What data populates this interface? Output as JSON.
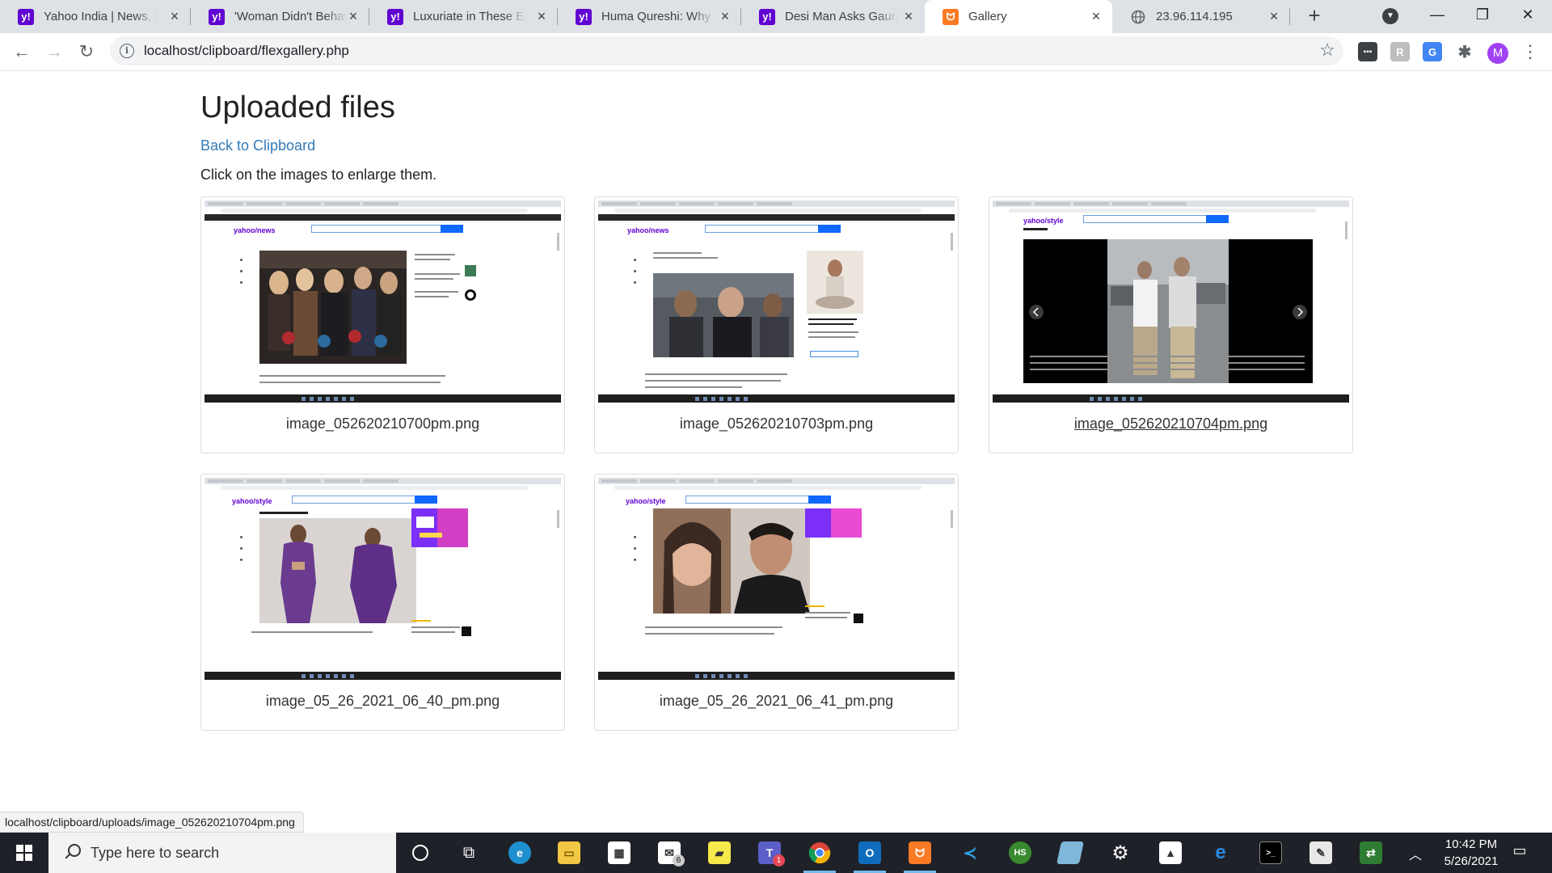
{
  "browser": {
    "tabs": [
      {
        "title": "Yahoo India | News, Fi",
        "favicon": "yahoo-icon",
        "active": false
      },
      {
        "title": "'Woman Didn't Behav",
        "favicon": "yahoo-icon",
        "active": false
      },
      {
        "title": "Luxuriate in These Ear",
        "favicon": "yahoo-icon",
        "active": false
      },
      {
        "title": "Huma Qureshi: Why D",
        "favicon": "yahoo-icon",
        "active": false
      },
      {
        "title": "Desi Man Asks Gauri K",
        "favicon": "yahoo-icon",
        "active": false
      },
      {
        "title": "Gallery",
        "favicon": "xampp-icon",
        "active": true
      },
      {
        "title": "23.96.114.195",
        "favicon": "globe-icon",
        "active": false
      }
    ],
    "url": "localhost/clipboard/flexgallery.php",
    "profile_initial": "M",
    "status_url": "localhost/clipboard/uploads/image_052620210704pm.png"
  },
  "page": {
    "heading": "Uploaded files",
    "back_link": "Back to Clipboard",
    "hint": "Click on the images to enlarge them.",
    "images": [
      {
        "filename": "image_052620210700pm.png",
        "preview": "yahoo/news"
      },
      {
        "filename": "image_052620210703pm.png",
        "preview": "yahoo/news"
      },
      {
        "filename": "image_052620210704pm.png",
        "preview": "yahoo/style",
        "hovered": true
      },
      {
        "filename": "image_05_26_2021_06_40_pm.png",
        "preview": "yahoo/style"
      },
      {
        "filename": "image_05_26_2021_06_41_pm.png",
        "preview": "yahoo/style"
      }
    ]
  },
  "taskbar": {
    "search_placeholder": "Type here to search",
    "mail_badge": "6",
    "teams_badge": "1",
    "time": "10:42 PM",
    "date": "5/26/2021"
  },
  "colors": {
    "link": "#337ab7",
    "yahoo_purple": "#6001d2",
    "tabstrip": "#dee1e6",
    "taskbar": "#1f2128"
  }
}
